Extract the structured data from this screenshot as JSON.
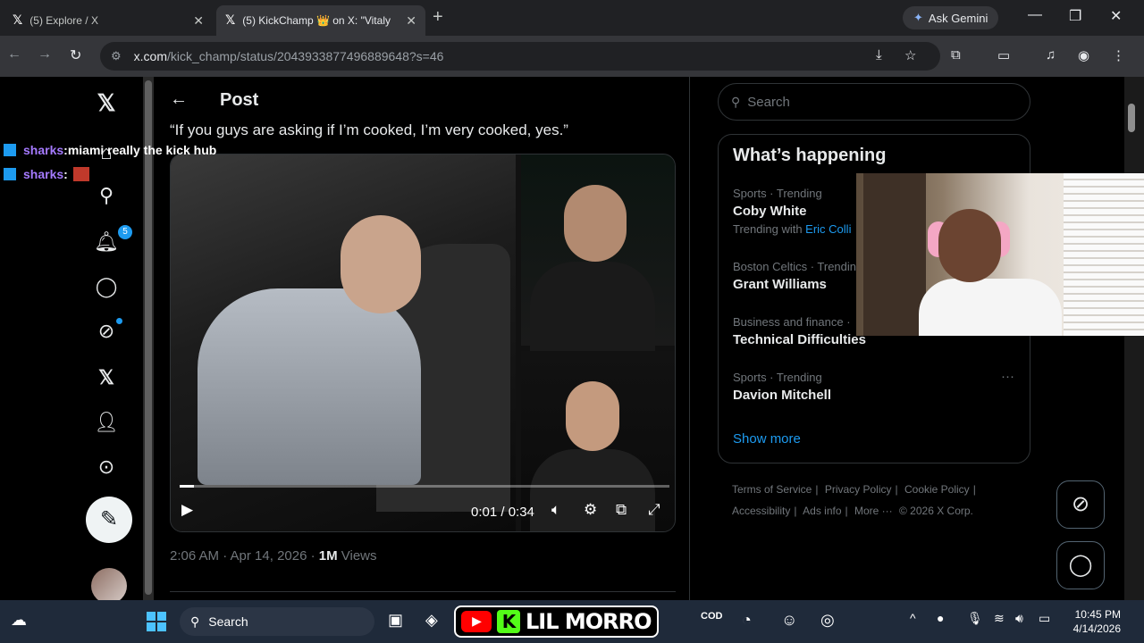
{
  "browser": {
    "tabs": [
      {
        "title": "(5) Explore / X"
      },
      {
        "title": "(5) KickChamp 👑 on X: \"Vitaly"
      }
    ],
    "ask_gemini": "Ask Gemini",
    "url_main": "x.com",
    "url_rest": "/kick_champ/status/2043933877496889648?s=46"
  },
  "x": {
    "header_title": "Post",
    "quote": "“If you guys are asking if I’m cooked, I’m very cooked, yes.”",
    "notifications_badge": "5",
    "video": {
      "time": "0:01 / 0:34",
      "progress_fraction": 0.03
    },
    "meta_time": "2:06 AM · Apr 14, 2026 · ",
    "meta_views_count": "1M",
    "meta_views_label": " Views",
    "search_placeholder": "Search",
    "happening_title": "What’s happening",
    "trends": [
      {
        "context": "Sports · Trending",
        "name": "Coby White",
        "with_label": "Trending with ",
        "with_link": "Eric Colli"
      },
      {
        "context": "Boston Celtics · Trendin",
        "name": "Grant Williams"
      },
      {
        "context": "Business and finance ·",
        "name": "Technical Difficulties"
      },
      {
        "context": "Sports · Trending",
        "name": "Davion Mitchell"
      }
    ],
    "show_more": "Show more",
    "footer": [
      "Terms of Service",
      "|",
      "Privacy Policy",
      "|",
      "Cookie Policy",
      "|",
      "Accessibility",
      "|",
      "Ads info",
      "|",
      "More ···",
      "© 2026 X Corp."
    ]
  },
  "overlay": {
    "chat": [
      {
        "user": "sharks",
        "sep": " : ",
        "msg": "miami really the kick hub"
      },
      {
        "user": "sharks",
        "sep": " : ",
        "msg": ""
      }
    ],
    "brand": "LIL MORRO"
  },
  "taskbar": {
    "search": "Search",
    "time": "10:45 PM",
    "date": "4/14/2026"
  },
  "icons": {
    "accent": "#1d9bf0",
    "kick_green": "#53fc18"
  }
}
